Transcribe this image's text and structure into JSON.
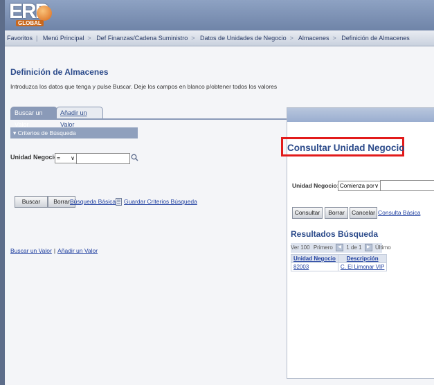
{
  "app": {
    "logo_text": "ERP",
    "logo_subtext": "GLOBAL"
  },
  "breadcrumb": {
    "items": [
      "Favoritos",
      "Menú Principal",
      "Def Finanzas/Cadena Suministro",
      "Datos de Unidades de Negocio",
      "Almacenes",
      "Definición de Almacenes"
    ],
    "separator": ">"
  },
  "main": {
    "title": "Definición de Almacenes",
    "instructions": "Introduzca los datos que tenga y pulse Buscar. Deje los campos en blanco p/obtener todos los valores",
    "tabs": [
      {
        "label": "Buscar un Valor",
        "active": true
      },
      {
        "label": "Añadir un Valor",
        "active": false
      }
    ],
    "criteria_header": "Criterios de Búsqueda",
    "criteria_toggle_icon": "triangle-down-icon",
    "field_label": "Unidad Negocio:",
    "operator_value": "=",
    "field_value": "",
    "buttons": {
      "search": "Buscar",
      "clear": "Borrar",
      "basic_search": "Búsqueda Básica",
      "save_criteria": "Guardar Criterios Búsqueda"
    },
    "bottom_links": [
      "Buscar un Valor",
      "Añadir un Valor"
    ]
  },
  "popup": {
    "title": "Consultar Unidad Negocio",
    "field_label": "Unidad Negocio:",
    "operator_value": "Comienza por",
    "field_value": "",
    "buttons": {
      "search": "Consultar",
      "clear": "Borrar",
      "cancel": "Cancelar",
      "basic": "Consulta Básica"
    },
    "results_title": "Resultados Búsqueda",
    "nav": {
      "view": "Ver 100",
      "first": "Primero",
      "range": "1 de 1",
      "last": "Último"
    },
    "columns": [
      "Unidad Negocio",
      "Descripción"
    ],
    "rows": [
      [
        "82003",
        "C. El Limonar VIP"
      ]
    ]
  },
  "colors": {
    "accent_blue": "#2b4a8a",
    "link_blue": "#1f3fa0",
    "highlight_red": "#e21b1b"
  }
}
